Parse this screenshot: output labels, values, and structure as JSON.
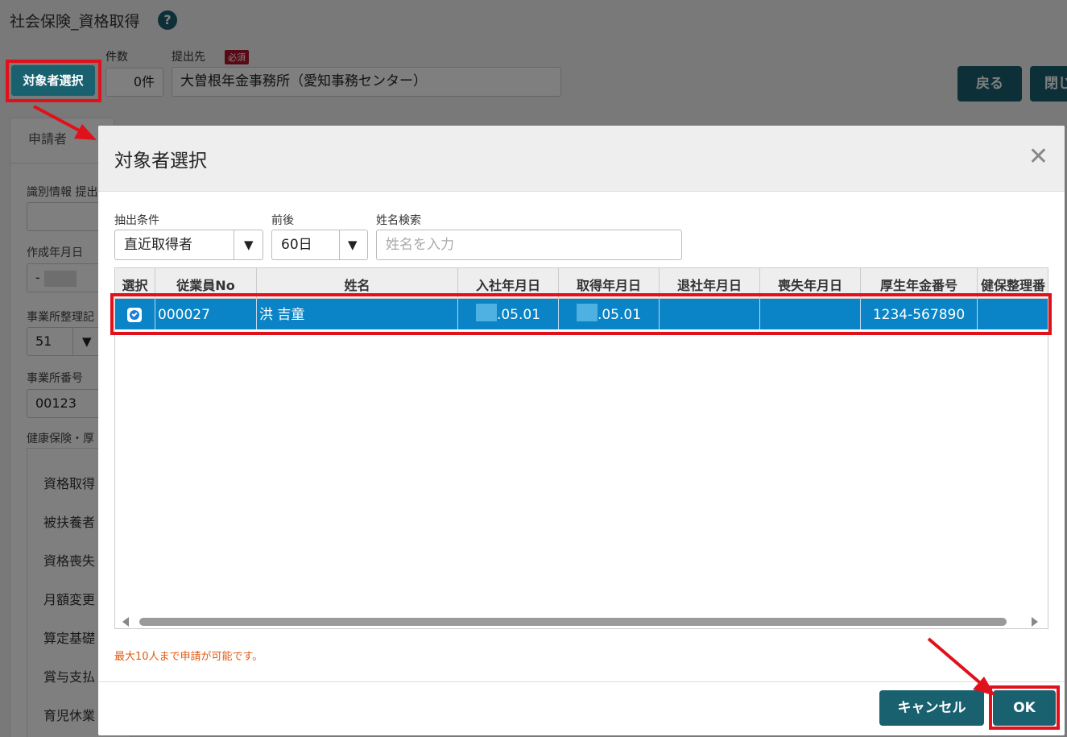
{
  "page": {
    "title": "社会保険_資格取得",
    "help_icon": "question-circle-icon",
    "select_target_label": "対象者選択",
    "count_label": "件数",
    "count_value": "0件",
    "destination_label": "提出先",
    "required_badge": "必須",
    "destination_value": "大曽根年金事務所（愛知事務センター）",
    "back_label": "戻る",
    "close_label": "閉じ",
    "tab_applicant": "申請者",
    "form": {
      "id_info_label": "識別情報 提出",
      "created_date_label": "作成年月日",
      "created_date_value": "-",
      "office_code_label": "事業所整理記",
      "office_code_value": "51",
      "office_number_label": "事業所番号",
      "office_number_value": "00123",
      "insurance_label": "健康保険・厚"
    },
    "menu": [
      "資格取得",
      "被扶養者",
      "資格喪失",
      "月額変更",
      "算定基礎",
      "賞与支払",
      "育児休業"
    ]
  },
  "modal": {
    "title": "対象者選択",
    "close_icon": "close-x-icon",
    "filter_label": "抽出条件",
    "filter_value": "直近取得者",
    "range_label": "前後",
    "range_value": "60日",
    "name_search_label": "姓名検索",
    "name_search_placeholder": "姓名を入力",
    "columns": [
      "選択",
      "従業員No",
      "姓名",
      "入社年月日",
      "取得年月日",
      "退社年月日",
      "喪失年月日",
      "厚生年金番号",
      "健保整理番"
    ],
    "row": {
      "selected": true,
      "employee_no": "000027",
      "name": "洪 吉童",
      "join_date": ".05.01",
      "acquire_date": ".05.01",
      "leave_date": "",
      "loss_date": "",
      "pension_no": "1234-567890",
      "health_no": ""
    },
    "note": "最大10人まで申請が可能です。",
    "cancel_label": "キャンセル",
    "ok_label": "OK"
  },
  "colors": {
    "teal": "#1a6170",
    "highlight_red": "#e0111b",
    "selected_row": "#0a84c6",
    "note_orange": "#e05a12"
  }
}
